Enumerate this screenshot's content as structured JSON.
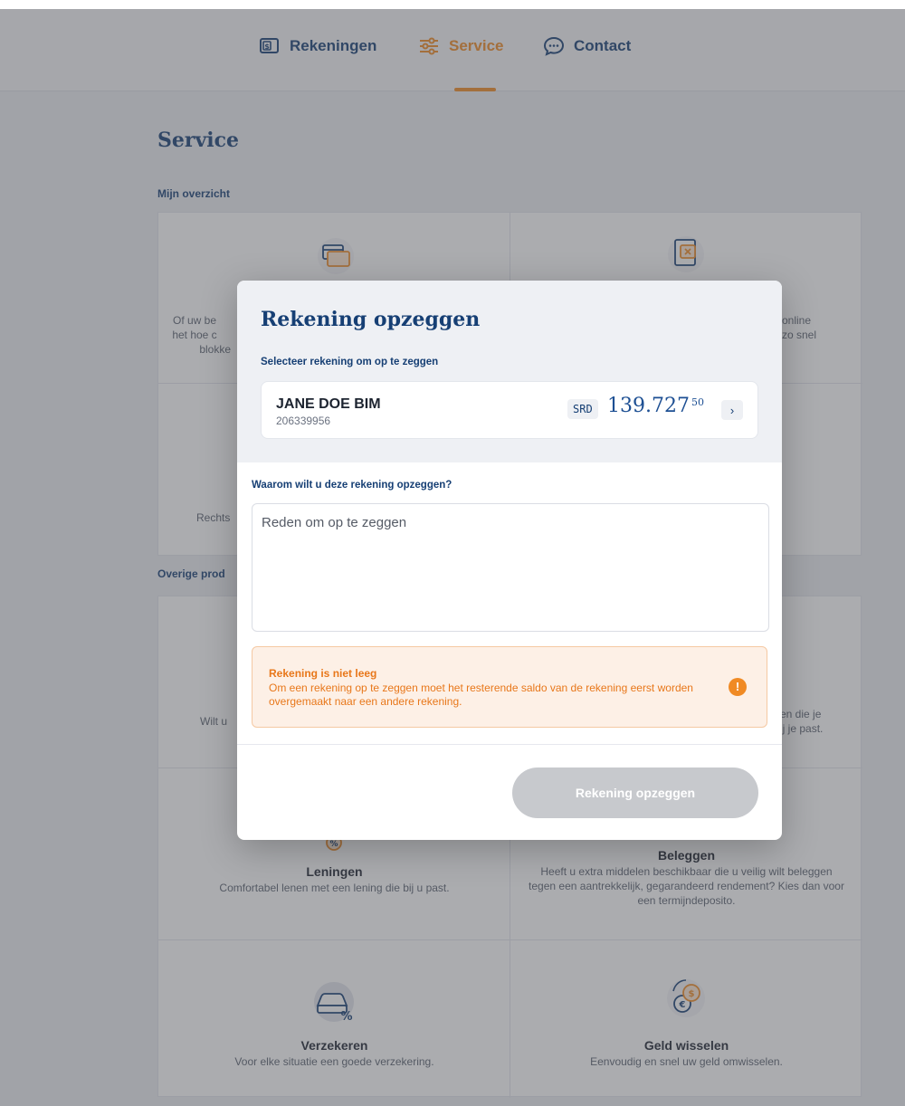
{
  "nav": {
    "items": [
      {
        "label": "Rekeningen",
        "icon": "wallet-icon"
      },
      {
        "label": "Service",
        "icon": "sliders-icon"
      },
      {
        "label": "Contact",
        "icon": "chat-icon"
      }
    ]
  },
  "page": {
    "title": "Service",
    "section_overview": "Mijn overzicht",
    "section_other": "Overige prod",
    "cells": {
      "card_text_left": [
        "Of uw be",
        "het hoe c",
        "blokke"
      ],
      "online_text": [
        "online",
        "zo snel"
      ],
      "rechts_text": "Rechts",
      "wilt_text": "Wilt u",
      "je_text": [
        "en die je",
        "ij je past."
      ],
      "leningen": {
        "title": "Leningen",
        "text": "Comfortabel lenen met een lening die bij u past."
      },
      "beleggen": {
        "title": "Beleggen",
        "text": "Heeft u extra middelen beschikbaar die u veilig wilt beleggen tegen een aantrekkelijk, gegarandeerd rendement? Kies dan voor een termijndeposito."
      },
      "verzekeren": {
        "title": "Verzekeren",
        "text": "Voor elke situatie een goede verzekering."
      },
      "geld_wisselen": {
        "title": "Geld wisselen",
        "text": "Eenvoudig en snel uw geld omwisselen."
      }
    }
  },
  "modal": {
    "title": "Rekening opzeggen",
    "select_label": "Selecteer rekening om op te zeggen",
    "account": {
      "name": "JANE DOE BIM",
      "number": "206339956",
      "currency": "SRD",
      "amount_main": "139.727",
      "amount_cents": "50"
    },
    "reason_label": "Waarom wilt u deze rekening opzeggen?",
    "reason_placeholder": "Reden om op te zeggen",
    "warning": {
      "title": "Rekening is niet leeg",
      "text": "Om een rekening op te zeggen moet het resterende saldo van de rekening eerst worden overgemaakt naar een andere rekening."
    },
    "submit_label": "Rekening opzeggen"
  },
  "colors": {
    "brand_blue": "#163f74",
    "accent_orange": "#f08a24",
    "warning_bg": "#fdf0e6",
    "disabled_button": "#c7c9cd"
  }
}
